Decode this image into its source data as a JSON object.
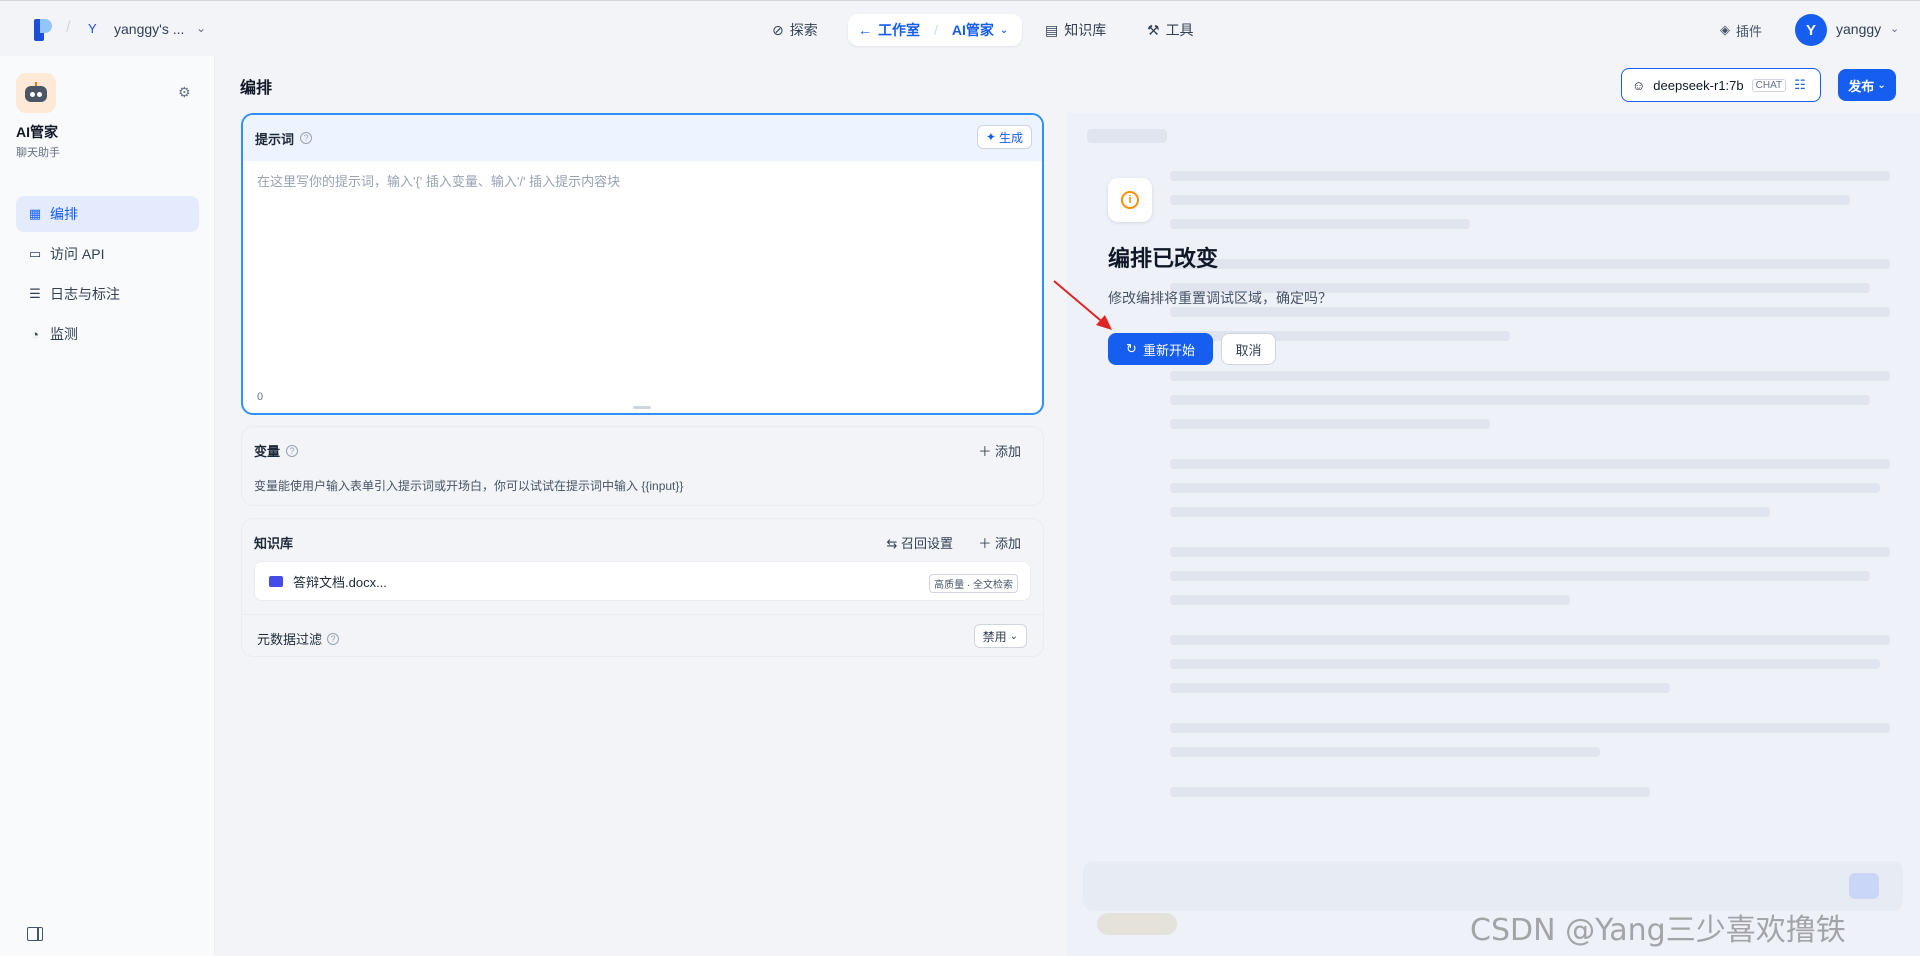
{
  "topnav": {
    "workspace_initial": "Y",
    "workspace_name": "yanggy's ...",
    "explore": "探索",
    "studio": "工作室",
    "current_app": "AI管家",
    "knowledge": "知识库",
    "tools": "工具",
    "plugins": "插件",
    "user_initial": "Y",
    "user_name": "yanggy"
  },
  "sidebar": {
    "app_title": "AI管家",
    "app_subtitle": "聊天助手",
    "items": [
      {
        "label": "编排",
        "icon": "layout-icon",
        "active": true
      },
      {
        "label": "访问 API",
        "icon": "terminal-icon",
        "active": false
      },
      {
        "label": "日志与标注",
        "icon": "file-list-icon",
        "active": false
      },
      {
        "label": "监测",
        "icon": "dashboard-icon",
        "active": false
      }
    ]
  },
  "header": {
    "title": "编排",
    "model": "deepseek-r1:7b",
    "model_badge": "CHAT",
    "publish": "发布"
  },
  "prompt": {
    "title": "提示词",
    "generate": "生成",
    "placeholder": "在这里写你的提示词，输入'{' 插入变量、输入'/' 插入提示内容块",
    "count": "0"
  },
  "variables": {
    "title": "变量",
    "add": "添加",
    "description": "变量能使用户输入表单引入提示词或开场白，你可以试试在提示词中输入 {{input}}"
  },
  "knowledge": {
    "title": "知识库",
    "recall_settings": "召回设置",
    "add": "添加",
    "doc_name": "答辩文档.docx...",
    "doc_badge": "高质量 · 全文检索",
    "metadata_filter": "元数据过滤",
    "metadata_value": "禁用"
  },
  "dialog": {
    "title": "编排已改变",
    "body": "修改编排将重置调试区域，确定吗？",
    "restart": "重新开始",
    "cancel": "取消"
  },
  "watermark": "CSDN @Yang三少喜欢撸铁",
  "colors": {
    "primary": "#155eef",
    "warning": "#f79009",
    "arrow": "#e02424"
  }
}
